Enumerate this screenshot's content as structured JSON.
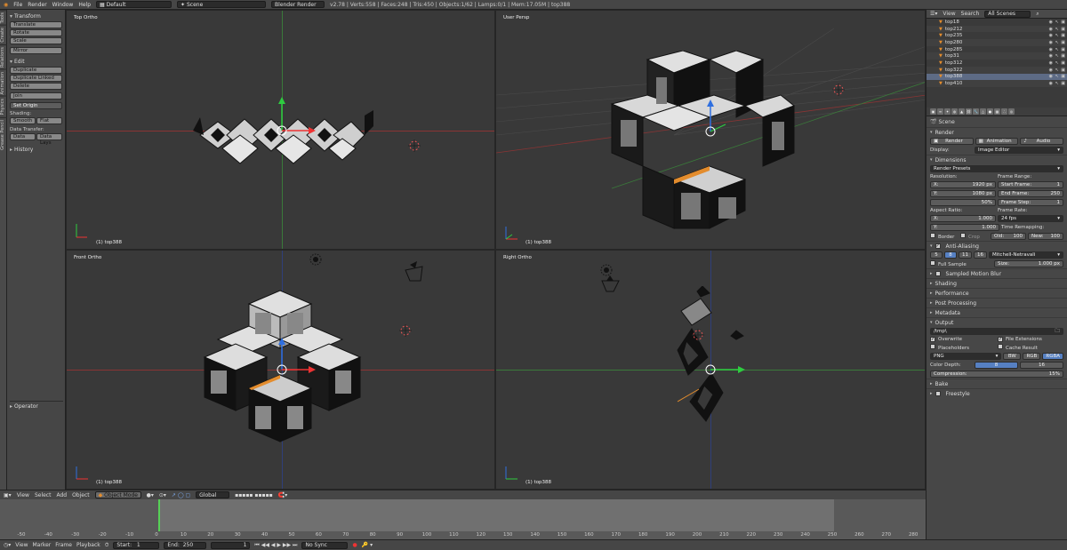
{
  "topbar": {
    "menus": [
      "File",
      "Render",
      "Window",
      "Help"
    ],
    "screen_layout": "Default",
    "scene": "Scene",
    "engine": "Blender Render",
    "stats": "v2.78 | Verts:558 | Faces:248 | Tris:450 | Objects:1/62 | Lamps:0/1 | Mem:17.05M | top388"
  },
  "toolstrip_tabs": [
    "Tools",
    "Create",
    "Relations",
    "Animation",
    "Physics",
    "Grease Pencil"
  ],
  "toolshelf": {
    "transform_title": "Transform",
    "transform": [
      "Translate",
      "Rotate",
      "Scale",
      "Mirror"
    ],
    "edit_title": "Edit",
    "edit": [
      "Duplicate",
      "Duplicate Linked",
      "Delete",
      "Join",
      "Set Origin"
    ],
    "shading_label": "Shading:",
    "smooth": "Smooth",
    "flat": "Flat",
    "data_transfer_label": "Data Transfer:",
    "data": "Data",
    "data_lays": "Data Lays",
    "history": "History",
    "operator": "Operator"
  },
  "viewports": {
    "top": {
      "name": "Top Ortho",
      "obj": "(1) top388"
    },
    "persp": {
      "name": "User Persp",
      "obj": "(1) top388"
    },
    "front": {
      "name": "Front Ortho",
      "obj": "(1) top388"
    },
    "right": {
      "name": "Right Ortho",
      "obj": "(1) top388"
    }
  },
  "vpheader": {
    "menus": [
      "View",
      "Select",
      "Add",
      "Object"
    ],
    "mode": "Object Mode",
    "orientation": "Global"
  },
  "timeline": {
    "ticks": [
      "-50",
      "-40",
      "-30",
      "-20",
      "-10",
      "0",
      "10",
      "20",
      "30",
      "40",
      "50",
      "60",
      "70",
      "80",
      "90",
      "100",
      "110",
      "120",
      "130",
      "140",
      "150",
      "160",
      "170",
      "180",
      "190",
      "200",
      "210",
      "220",
      "230",
      "240",
      "250",
      "260",
      "270",
      "280"
    ],
    "current_frame": 1
  },
  "bottombar": {
    "menus": [
      "View",
      "Marker",
      "Frame",
      "Playback"
    ],
    "start_label": "Start:",
    "start": "1",
    "end_label": "End:",
    "end": "250",
    "frame": "1",
    "sync": "No Sync"
  },
  "outliner": {
    "menus": [
      "View",
      "Search"
    ],
    "filter": "All Scenes",
    "items": [
      "top18",
      "top212",
      "top235",
      "top280",
      "top285",
      "top31",
      "top312",
      "top322",
      "top388",
      "top410"
    ]
  },
  "properties": {
    "scene": "Scene",
    "render": {
      "title": "Render",
      "render_btn": "Render",
      "anim_btn": "Animation",
      "audio_btn": "Audio",
      "display_label": "Display:",
      "display": "Image Editor"
    },
    "dimensions": {
      "title": "Dimensions",
      "presets": "Render Presets",
      "resolution_label": "Resolution:",
      "x_label": "X:",
      "x": "1920 px",
      "y_label": "Y:",
      "y": "1080 px",
      "percent": "50%",
      "frame_range_label": "Frame Range:",
      "start_label": "Start Frame:",
      "start": "1",
      "end_label": "End Frame:",
      "end": "250",
      "step_label": "Frame Step:",
      "step": "1",
      "aspect_label": "Aspect Ratio:",
      "ax": "1.000",
      "ay": "1.000",
      "fps_label": "Frame Rate:",
      "fps": "24 fps",
      "remap_label": "Time Remapping:",
      "old_label": "Old:",
      "old": "100",
      "new_label": "New:",
      "new": "100",
      "border": "Border",
      "crop": "Crop"
    },
    "aa": {
      "title": "Anti-Aliasing",
      "samples": [
        "5",
        "8",
        "11",
        "16"
      ],
      "filter": "Mitchell-Netravali",
      "full_sample": "Full Sample",
      "size_label": "Size:",
      "size": "1.000 px"
    },
    "sections": [
      "Sampled Motion Blur",
      "Shading",
      "Performance",
      "Post Processing",
      "Metadata"
    ],
    "output": {
      "title": "Output",
      "path": "/tmp\\",
      "overwrite": "Overwrite",
      "file_ext": "File Extensions",
      "placeholders": "Placeholders",
      "cache": "Cache Result",
      "format": "PNG",
      "bw": "BW",
      "rgb": "RGB",
      "rgba": "RGBA",
      "depth_label": "Color Depth:",
      "d8": "8",
      "d16": "16",
      "comp_label": "Compression:",
      "comp": "15%"
    },
    "bake": "Bake",
    "freestyle": "Freestyle"
  }
}
